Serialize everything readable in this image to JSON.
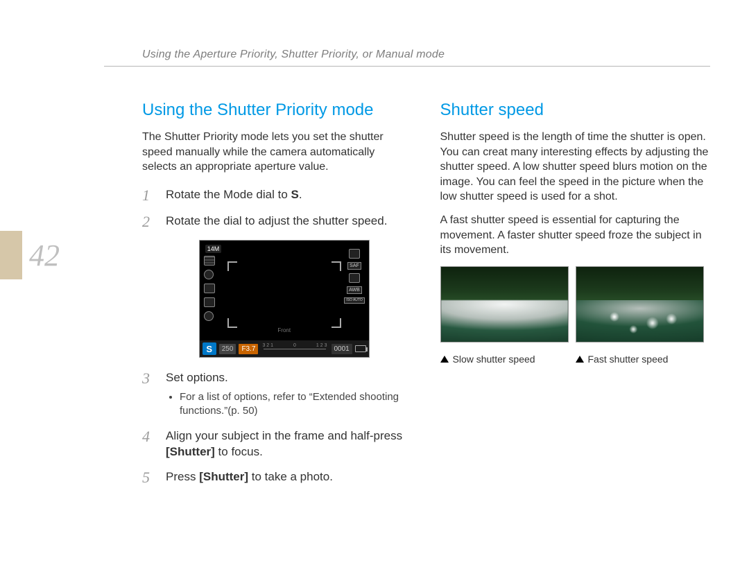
{
  "header": {
    "breadcrumb": "Using the Aperture Priority, Shutter Priority, or Manual mode"
  },
  "page_number": "42",
  "left": {
    "title": "Using the Shutter Priority mode",
    "intro": "The Shutter Priority mode lets you set the shutter speed manually while the camera automatically selects an appropriate aperture value.",
    "step1_pre": "Rotate the Mode dial to ",
    "step1_bold": "S",
    "step1_post": ".",
    "step2": "Rotate the dial to adjust the shutter speed.",
    "step3": "Set options.",
    "step3_bullet": "For a list of options, refer to “Extended shooting functions.”(p. 50)",
    "step4_pre": "Align your subject in the frame and half-press ",
    "step4_bold": "[Shutter]",
    "step4_post": " to focus.",
    "step5_pre": "Press ",
    "step5_bold": "[Shutter]",
    "step5_post": " to take a photo.",
    "num1": "1",
    "num2": "2",
    "num3": "3",
    "num4": "4",
    "num5": "5"
  },
  "screen": {
    "size": "14M",
    "mode": "S",
    "shutter": "250",
    "aperture": "F3.7",
    "scale_left": "3  2  1",
    "scale_mid": "0",
    "scale_right": "1  2  3",
    "counter": "0001",
    "hint": "Front",
    "right_saf": "SAF",
    "right_awb": "AWB",
    "right_iso": "ISO AUTO"
  },
  "right": {
    "title": "Shutter speed",
    "p1": "Shutter speed is the length of time the shutter is open. You can creat many interesting effects by adjusting the shutter speed. A low shutter speed blurs motion on the image. You can feel the speed in the picture when the low shutter speed is used for a shot.",
    "p2": "A fast shutter speed is essential for capturing the movement. A faster shutter speed froze the subject in its movement.",
    "caption_slow": "Slow shutter speed",
    "caption_fast": "Fast shutter speed"
  }
}
